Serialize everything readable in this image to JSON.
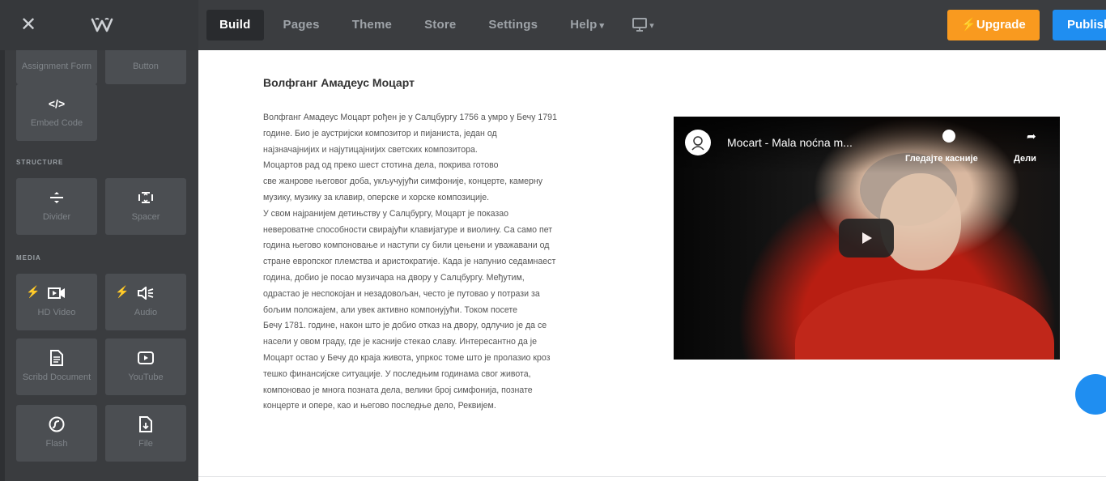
{
  "topbar": {
    "close_label": "✕",
    "nav": [
      {
        "label": "Build"
      },
      {
        "label": "Pages"
      },
      {
        "label": "Theme"
      },
      {
        "label": "Store"
      },
      {
        "label": "Settings"
      },
      {
        "label": "Help"
      }
    ],
    "help_caret": "▾",
    "device_caret": "▾",
    "upgrade_label": "Upgrade",
    "publish_label": "Publish"
  },
  "sidebar": {
    "top_tiles": [
      {
        "label": "Assignment Form",
        "icon": "form-icon"
      },
      {
        "label": "Button",
        "icon": "button-icon"
      }
    ],
    "embed": {
      "label": "Embed Code",
      "icon": "code-icon",
      "glyph": "</>"
    },
    "sections": {
      "structure": "STRUCTURE",
      "media": "MEDIA"
    },
    "structure_tiles": [
      {
        "label": "Divider",
        "icon": "divider-icon"
      },
      {
        "label": "Spacer",
        "icon": "spacer-icon"
      }
    ],
    "media_tiles": [
      {
        "label": "HD Video",
        "icon": "hd-video-icon",
        "premium": true
      },
      {
        "label": "Audio",
        "icon": "audio-icon",
        "premium": true
      },
      {
        "label": "Scribd Document",
        "icon": "document-icon"
      },
      {
        "label": "YouTube",
        "icon": "youtube-icon"
      },
      {
        "label": "Flash",
        "icon": "flash-icon"
      },
      {
        "label": "File",
        "icon": "file-icon"
      }
    ]
  },
  "article": {
    "title": "Волфганг Амадеус Моцарт",
    "lines": [
      "Волфганг Амадеус Моцарт рођен је у Салцбургу 1756 а умро у Бечу 1791",
      "године. Био је аустријски композитор и пијаниста, један од",
      "најзначајнијих и најутицајнијих светских композитора.",
      "Моцартов рад од преко шест стотина дела, покрива готово",
      "све жанрове његовог доба, укључујући симфоније, концерте, камерну",
      "музику, музику за клавир, оперске и хорске композиције.",
      "У свом најранијем детињству у Салцбургу, Моцарт је показао",
      "невероватне способности свирајући клавијатуре и виолину. Са само пет",
      "година његово компоновање и наступи су били цењени и уважавани од",
      "стране европског племства и аристократије. Када је напунио седамнаест",
      "година, добио је посао музичара на двору у Салцбургу. Међутим,",
      "одрастао је неспокојан и незадовољан, често је путовао у потрази за",
      "бољим положајем, али увек активно компонујући. Током посете",
      "Бечу 1781. године, након што је добио отказ на двору, одлучио је да се",
      "насели у овом граду, где је касније стекао славу. Интересантно да је",
      "Моцарт остао у Бечу до краја живота, упркос томе што је пролазио кроз",
      "тешко финансијске ситуације. У последњим годинама свог живота,",
      "компоновао је многа позната дела, велики број симфонија, познате",
      "концерте и опере, као и његово последње дело, Реквијем."
    ]
  },
  "video": {
    "title": "Mocart - Mala noćna m...",
    "watch_later": "Гледајте касније",
    "share": "Дели"
  }
}
